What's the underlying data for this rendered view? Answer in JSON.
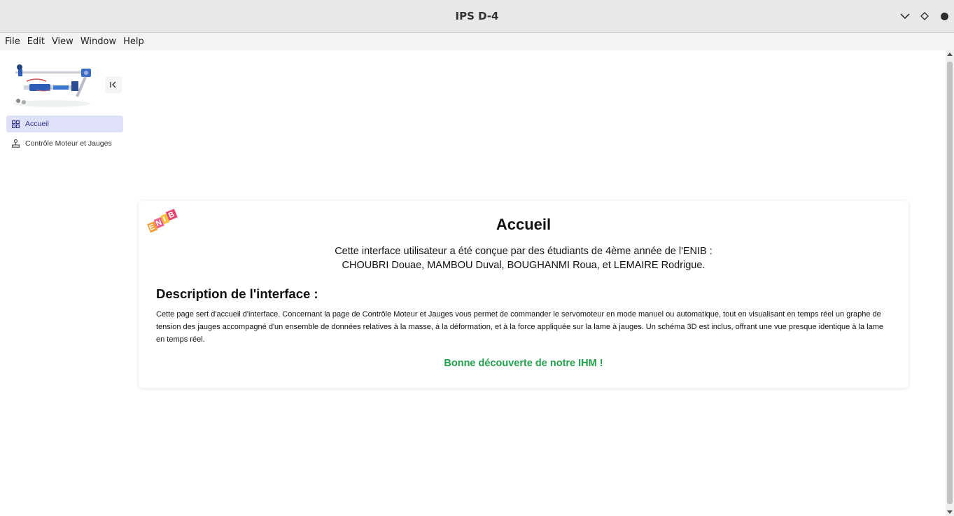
{
  "window": {
    "title": "IPS D-4"
  },
  "menubar": {
    "items": [
      "File",
      "Edit",
      "View",
      "Window",
      "Help"
    ]
  },
  "sidebar": {
    "items": [
      {
        "label": "Accueil",
        "icon": "grid-icon",
        "active": true
      },
      {
        "label": "Contrôle Moteur et Jauges",
        "icon": "joystick-icon",
        "active": false
      }
    ]
  },
  "card": {
    "title": "Accueil",
    "credit_line1": "Cette interface utilisateur a été conçue par des étudiants de 4ème année de l'ENIB :",
    "credit_line2": "CHOUBRI Douae, MAMBOU Duval, BOUGHANMI Roua, et LEMAIRE Rodrigue.",
    "description_title": "Description de l'interface :",
    "description_text": "Cette page sert d'accueil d'interface. Concernant la page de Contrôle Moteur et Jauges vous permet de commander le servomoteur en mode manuel ou automatique, tout en visualisant en temps réel un graphe de tension des jauges accompagné d'un ensemble de données relatives à la masse, à la déformation, et à la force appliquée sur la lame à jauges. Un schéma 3D est inclus, offrant une vue presque identique à la lame en temps réel.",
    "cta": "Bonne découverte de notre IHM !",
    "logo_text": "ENIB"
  },
  "colors": {
    "active_nav_bg": "#dfe1fb",
    "active_nav_text": "#2c3190",
    "cta_green": "#22a04b"
  }
}
